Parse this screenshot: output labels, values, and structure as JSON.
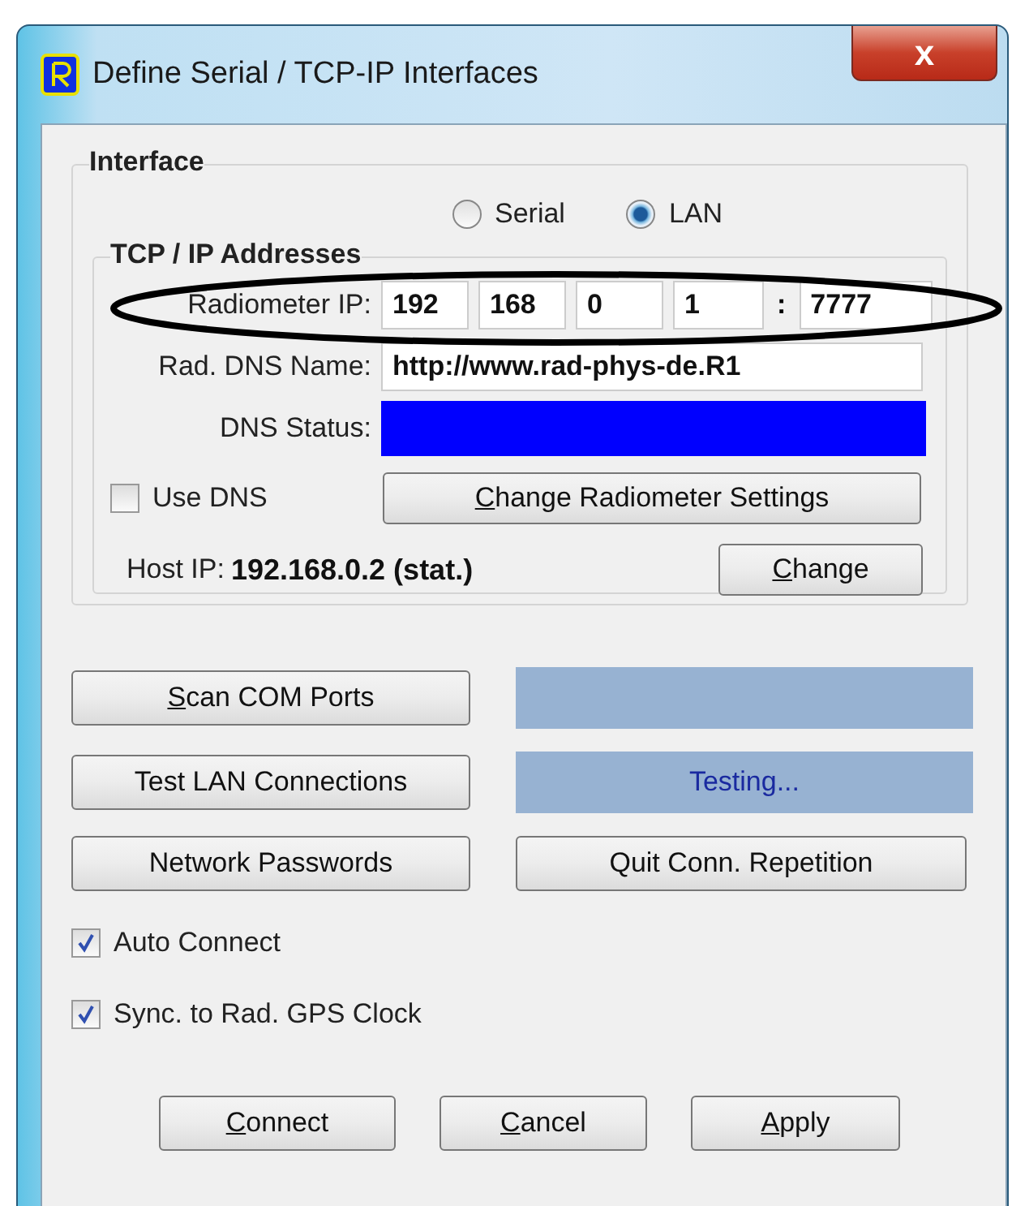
{
  "window": {
    "title": "Define Serial / TCP-IP Interfaces",
    "close": "x"
  },
  "interface": {
    "title": "Interface",
    "radios": [
      {
        "label": "Serial",
        "selected": false
      },
      {
        "label": "LAN",
        "selected": true
      }
    ],
    "tcpip": {
      "title": "TCP / IP Addresses",
      "ip_label": "Radiometer  IP:",
      "ip_octets": [
        "192",
        "168",
        "0",
        "1"
      ],
      "port_separator": ":",
      "port": "7777",
      "dns_name_label": "Rad. DNS Name:",
      "dns_name": "http://www.rad-phys-de.R1",
      "dns_status_label": "DNS Status:",
      "use_dns": {
        "label": "Use DNS",
        "checked": false
      },
      "change_settings": {
        "label": "Change Radiometer Settings",
        "underline_first": true
      },
      "host_label": "Host  IP:",
      "host_value": "192.168.0.2 (stat.)",
      "change": {
        "label": "Change",
        "underline_first": true
      }
    }
  },
  "actions": [
    {
      "button": {
        "label": "Scan COM Ports",
        "underline_first": true
      },
      "kind": "panel"
    },
    {
      "button": {
        "label": "Test LAN Connections",
        "underline_first": false
      },
      "kind": "panel",
      "status": "Testing..."
    },
    {
      "button": {
        "label": "Network Passwords",
        "underline_first": false
      },
      "kind": "button",
      "other": {
        "label": "Quit Conn. Repetition",
        "underline_first": false
      }
    }
  ],
  "options": [
    {
      "label": "Auto Connect",
      "checked": true
    },
    {
      "label": "Sync. to Rad. GPS Clock",
      "checked": true
    }
  ],
  "buttons": [
    {
      "label": "Connect",
      "underline_first": true
    },
    {
      "label": "Cancel",
      "underline_first": true
    },
    {
      "label": "Apply",
      "underline_first": true
    }
  ]
}
